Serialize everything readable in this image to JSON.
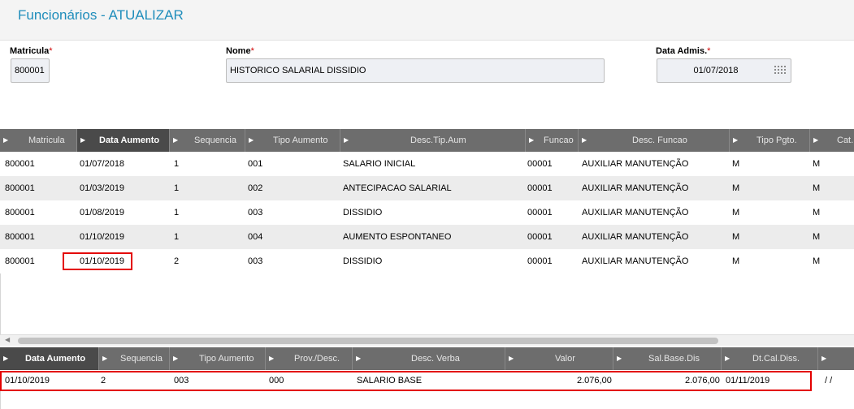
{
  "window": {
    "title": "Funcionários - ATUALIZAR"
  },
  "form": {
    "matricula": {
      "label": "Matricula",
      "required_mark": "*",
      "value": "800001"
    },
    "nome": {
      "label": "Nome",
      "required_mark": "*",
      "value": "HISTORICO SALARIAL DISSIDIO"
    },
    "data_admis": {
      "label": "Data Admis.",
      "required_mark": "*",
      "value": "01/07/2018",
      "icon": "calendar-icon"
    }
  },
  "grid1": {
    "columns": [
      "Matricula",
      "Data Aumento",
      "Sequencia",
      "Tipo Aumento",
      "Desc.Tip.Aum",
      "Funcao",
      "Desc. Funcao",
      "Tipo Pgto.",
      "Cat."
    ],
    "active_column": "Data Aumento",
    "rows": [
      [
        "800001",
        "01/07/2018",
        "1",
        "001",
        "SALARIO INICIAL",
        "00001",
        "AUXILIAR MANUTENÇÃO",
        "M",
        "M"
      ],
      [
        "800001",
        "01/03/2019",
        "1",
        "002",
        "ANTECIPACAO SALARIAL",
        "00001",
        "AUXILIAR MANUTENÇÃO",
        "M",
        "M"
      ],
      [
        "800001",
        "01/08/2019",
        "1",
        "003",
        "DISSIDIO",
        "00001",
        "AUXILIAR MANUTENÇÃO",
        "M",
        "M"
      ],
      [
        "800001",
        "01/10/2019",
        "1",
        "004",
        "AUMENTO ESPONTANEO",
        "00001",
        "AUXILIAR MANUTENÇÃO",
        "M",
        "M"
      ],
      [
        "800001",
        "01/10/2019",
        "2",
        "003",
        "DISSIDIO",
        "00001",
        "AUXILIAR MANUTENÇÃO",
        "M",
        "M"
      ]
    ]
  },
  "grid2": {
    "columns": [
      "Data Aumento",
      "Sequencia",
      "Tipo Aumento",
      "Prov./Desc.",
      "Desc. Verba",
      "Valor",
      "Sal.Base.Dis",
      "Dt.Cal.Diss."
    ],
    "active_column": "Data Aumento",
    "rows": [
      [
        "01/10/2019",
        "2",
        "003",
        "000",
        "SALARIO BASE",
        "2.076,00",
        "2.076,00",
        "01/11/2019",
        "/ /"
      ]
    ]
  },
  "colors": {
    "title": "#1f8dbb",
    "header_bg": "#6d6d6d",
    "highlight": "#e30000",
    "required": "#d00000"
  }
}
